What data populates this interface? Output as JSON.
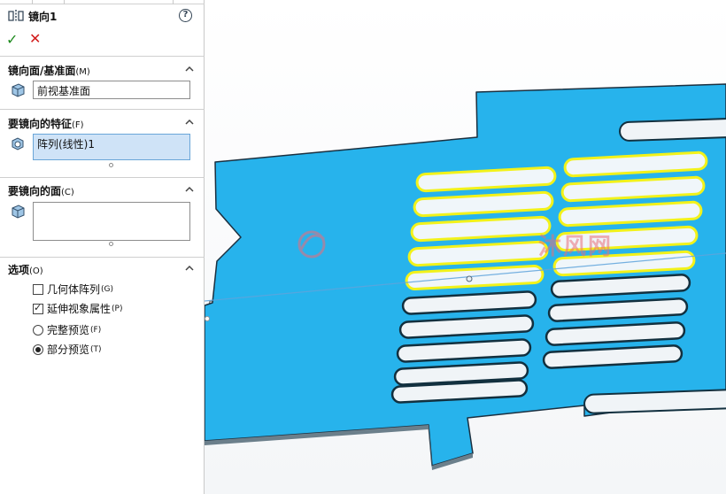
{
  "feature": {
    "title": "镜向1",
    "help_symbol": "?"
  },
  "sections": {
    "mirror_plane": {
      "title": "镜向面/基准面",
      "shortcut": "(M)",
      "value": "前视基准面"
    },
    "features": {
      "title": "要镜向的特征",
      "shortcut": "(F)",
      "value": "阵列(线性)1"
    },
    "faces": {
      "title": "要镜向的面",
      "shortcut": "(C)",
      "value": ""
    },
    "options": {
      "title": "选项",
      "shortcut": "(O)",
      "geometry_pattern": {
        "label": "几何体阵列",
        "shortcut": "(G)",
        "checked": false
      },
      "propagate_visual": {
        "label": "延伸视象属性",
        "shortcut": "(P)",
        "checked": true
      },
      "full_preview": {
        "label": "完整预览",
        "shortcut": "(F)",
        "selected": false
      },
      "partial_preview": {
        "label": "部分预览",
        "shortcut": "(T)",
        "selected": true
      }
    }
  },
  "icons": [
    "mirror-feature-icon",
    "help-icon",
    "ok-check-icon",
    "cancel-x-icon",
    "face-cube-icon",
    "feature-icon",
    "collapse-caret-icon"
  ],
  "colors": {
    "part_blue": "#27b3ec",
    "highlight_yellow": "#f2f21a",
    "ok_green": "#1e8a1e",
    "cancel_red": "#d21b1b"
  },
  "watermark": "沐风网"
}
